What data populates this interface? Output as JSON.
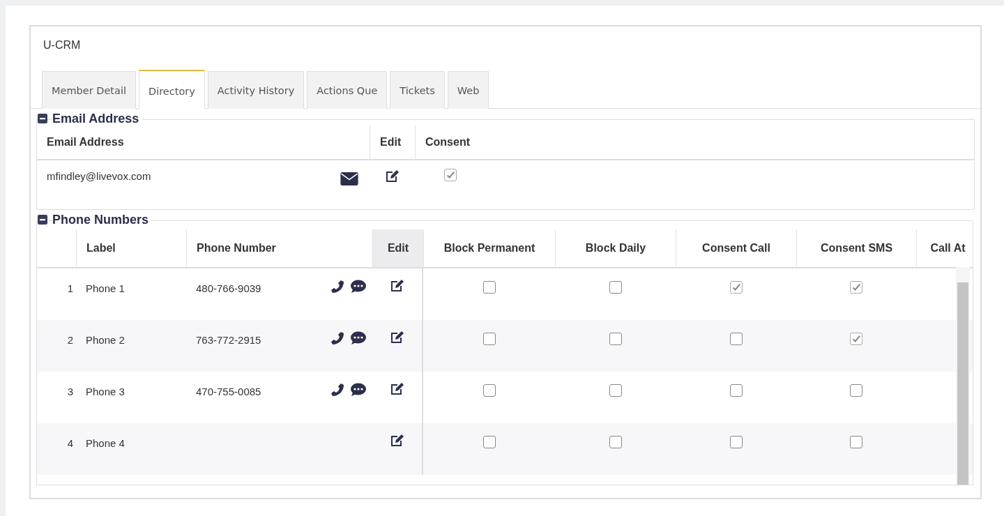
{
  "app": {
    "title": "U-CRM"
  },
  "tabs": [
    {
      "label": "Member Detail",
      "selected": false
    },
    {
      "label": "Directory",
      "selected": true
    },
    {
      "label": "Activity History",
      "selected": false
    },
    {
      "label": "Actions Que",
      "selected": false
    },
    {
      "label": "Tickets",
      "selected": false
    },
    {
      "label": "Web",
      "selected": false
    }
  ],
  "email_section": {
    "title": "Email Address",
    "columns": [
      "Email Address",
      "Edit",
      "Consent"
    ],
    "rows": [
      {
        "email": "mfindley@livevox.com",
        "consent": true
      }
    ]
  },
  "phone_section": {
    "title": "Phone Numbers",
    "columns": [
      "Label",
      "Phone Number",
      "Edit",
      "Block Permanent",
      "Block Daily",
      "Consent Call",
      "Consent SMS",
      "Call At"
    ],
    "rows": [
      {
        "index": "1",
        "label": "Phone 1",
        "number": "480-766-9039",
        "block_permanent": false,
        "block_daily": false,
        "consent_call": true,
        "consent_sms": true
      },
      {
        "index": "2",
        "label": "Phone 2",
        "number": "763-772-2915",
        "block_permanent": false,
        "block_daily": false,
        "consent_call": false,
        "consent_sms": true
      },
      {
        "index": "3",
        "label": "Phone 3",
        "number": "470-755-0085",
        "block_permanent": false,
        "block_daily": false,
        "consent_call": false,
        "consent_sms": false
      },
      {
        "index": "4",
        "label": "Phone 4",
        "block_permanent": false,
        "block_daily": false,
        "consent_call": false,
        "consent_sms": false
      }
    ]
  }
}
